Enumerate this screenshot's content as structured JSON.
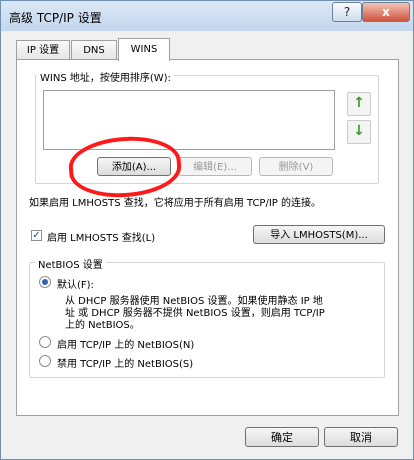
{
  "window": {
    "title": "高级 TCP/IP 设置",
    "help_label": "?",
    "close_label": "x"
  },
  "tabs": [
    {
      "label": "IP 设置"
    },
    {
      "label": "DNS"
    },
    {
      "label": "WINS"
    }
  ],
  "wins": {
    "group_label": "WINS 地址，按使用排序(W):",
    "add_label": "添加(A)...",
    "edit_label": "编辑(E)...",
    "delete_label": "删除(V)",
    "info_text": "如果启用 LMHOSTS 查找，它将应用于所有启用 TCP/IP 的连接。",
    "lmhosts_label": "启用 LMHOSTS 查找(L)",
    "import_label": "导入 LMHOSTS(M)..."
  },
  "netbios": {
    "group_label": "NetBIOS 设置",
    "default_label": "默认(F):",
    "default_desc_1": "从 DHCP 服务器使用 NetBIOS 设置。如果使用静态 IP 地",
    "default_desc_2": "址 或 DHCP 服务器不提供 NetBIOS 设置，则启用 TCP/IP",
    "default_desc_3": "上的 NetBIOS。",
    "enable_label": "启用 TCP/IP 上的 NetBIOS(N)",
    "disable_label": "禁用 TCP/IP 上的 NetBIOS(S)"
  },
  "footer": {
    "ok_label": "确定",
    "cancel_label": "取消"
  },
  "colors": {
    "annotation": "#ff1a1a",
    "arrow": "#3a9a2a"
  },
  "icons": {
    "up": "↑",
    "down": "↓",
    "check": "✓"
  }
}
